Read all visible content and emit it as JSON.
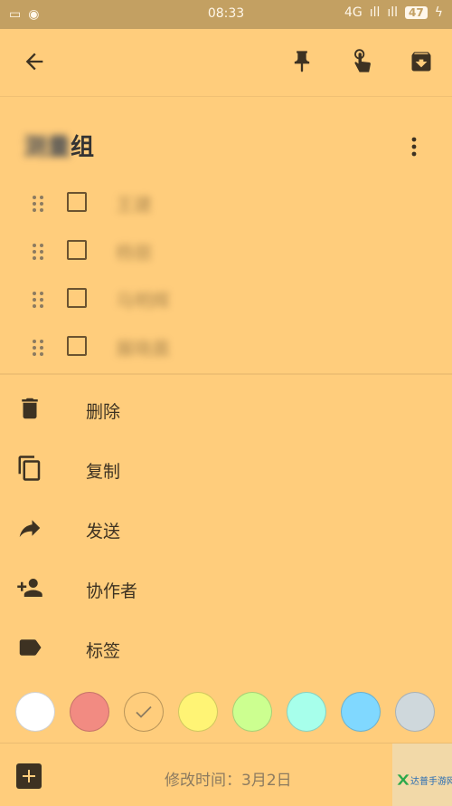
{
  "status_bar": {
    "time": "08:33",
    "network": "4G",
    "battery": "47"
  },
  "toolbar": {
    "back_icon": "arrow-left-icon",
    "pin_icon": "pin-icon",
    "reminder_icon": "reminder-hand-icon",
    "archive_icon": "archive-icon"
  },
  "note": {
    "title_blurred": "测量",
    "title_suffix": "组",
    "items": [
      {
        "text": "王建"
      },
      {
        "text": "杨丽"
      },
      {
        "text": "马明辉"
      },
      {
        "text": "展晓晨"
      }
    ]
  },
  "menu": {
    "items": [
      {
        "label": "删除",
        "icon": "trash-icon"
      },
      {
        "label": "复制",
        "icon": "copy-icon"
      },
      {
        "label": "发送",
        "icon": "share-icon"
      },
      {
        "label": "协作者",
        "icon": "add-person-icon"
      },
      {
        "label": "标签",
        "icon": "label-icon"
      }
    ]
  },
  "colors": {
    "swatches": [
      "#ffffff",
      "#f28b82",
      "#ffcd7c",
      "#fff475",
      "#ccff90",
      "#a7ffeb",
      "#80d8ff",
      "#cfd8dc"
    ],
    "selected": "#ffcd7c",
    "background": "#ffcd7c"
  },
  "footer": {
    "modified": "修改时间：3月2日",
    "watermark": "达普手游网"
  }
}
